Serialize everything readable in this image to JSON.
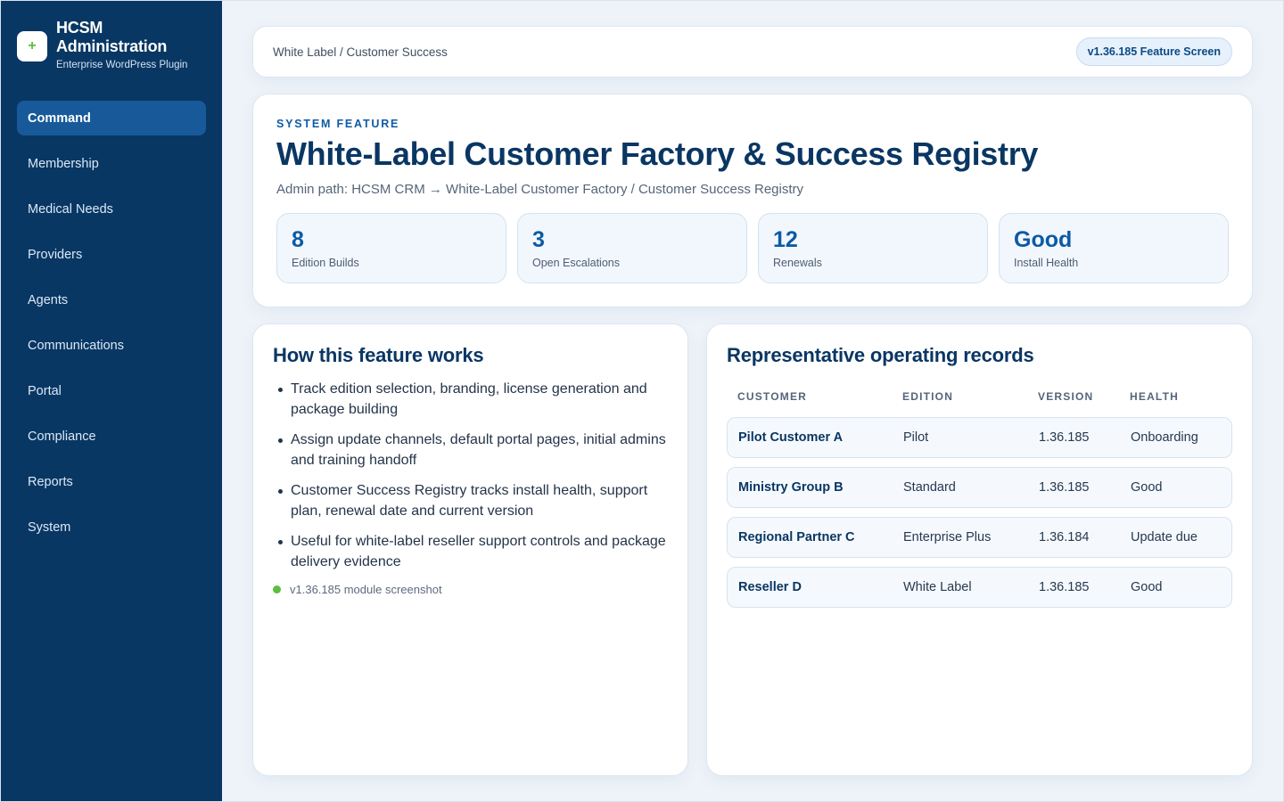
{
  "brand": {
    "logo_glyph": "+",
    "title": "HCSM Administration",
    "subtitle": "Enterprise WordPress Plugin"
  },
  "sidebar": {
    "items": [
      {
        "label": "Command",
        "active": true
      },
      {
        "label": "Membership",
        "active": false
      },
      {
        "label": "Medical Needs",
        "active": false
      },
      {
        "label": "Providers",
        "active": false
      },
      {
        "label": "Agents",
        "active": false
      },
      {
        "label": "Communications",
        "active": false
      },
      {
        "label": "Portal",
        "active": false
      },
      {
        "label": "Compliance",
        "active": false
      },
      {
        "label": "Reports",
        "active": false
      },
      {
        "label": "System",
        "active": false
      }
    ]
  },
  "topbar": {
    "breadcrumb": "White Label / Customer Success",
    "version_badge": "v1.36.185 Feature Screen"
  },
  "hero": {
    "eyebrow": "SYSTEM FEATURE",
    "title": "White-Label Customer Factory & Success Registry",
    "path": "Admin path: HCSM CRM → White-Label Customer Factory / Customer Success Registry",
    "stats": [
      {
        "value": "8",
        "label": "Edition Builds"
      },
      {
        "value": "3",
        "label": "Open Escalations"
      },
      {
        "value": "12",
        "label": "Renewals"
      },
      {
        "value": "Good",
        "label": "Install Health"
      }
    ]
  },
  "how": {
    "title": "How this feature works",
    "bullets": [
      "Track edition selection, branding, license generation and package building",
      "Assign update channels, default portal pages, initial admins and training handoff",
      "Customer Success Registry tracks install health, support plan, renewal date and current version",
      "Useful for white-label reseller support controls and package delivery evidence"
    ],
    "note": "v1.36.185 module screenshot"
  },
  "records": {
    "title": "Representative operating records",
    "columns": [
      "CUSTOMER",
      "EDITION",
      "VERSION",
      "HEALTH"
    ],
    "rows": [
      {
        "customer": "Pilot Customer A",
        "edition": "Pilot",
        "version": "1.36.185",
        "health": "Onboarding"
      },
      {
        "customer": "Ministry Group B",
        "edition": "Standard",
        "version": "1.36.185",
        "health": "Good"
      },
      {
        "customer": "Regional Partner C",
        "edition": "Enterprise Plus",
        "version": "1.36.184",
        "health": "Update due"
      },
      {
        "customer": "Reseller D",
        "edition": "White Label",
        "version": "1.36.185",
        "health": "Good"
      }
    ]
  },
  "colors": {
    "sidebar_bg": "#083764",
    "accent": "#0c5aa6",
    "status_green": "#5bbf3c"
  }
}
